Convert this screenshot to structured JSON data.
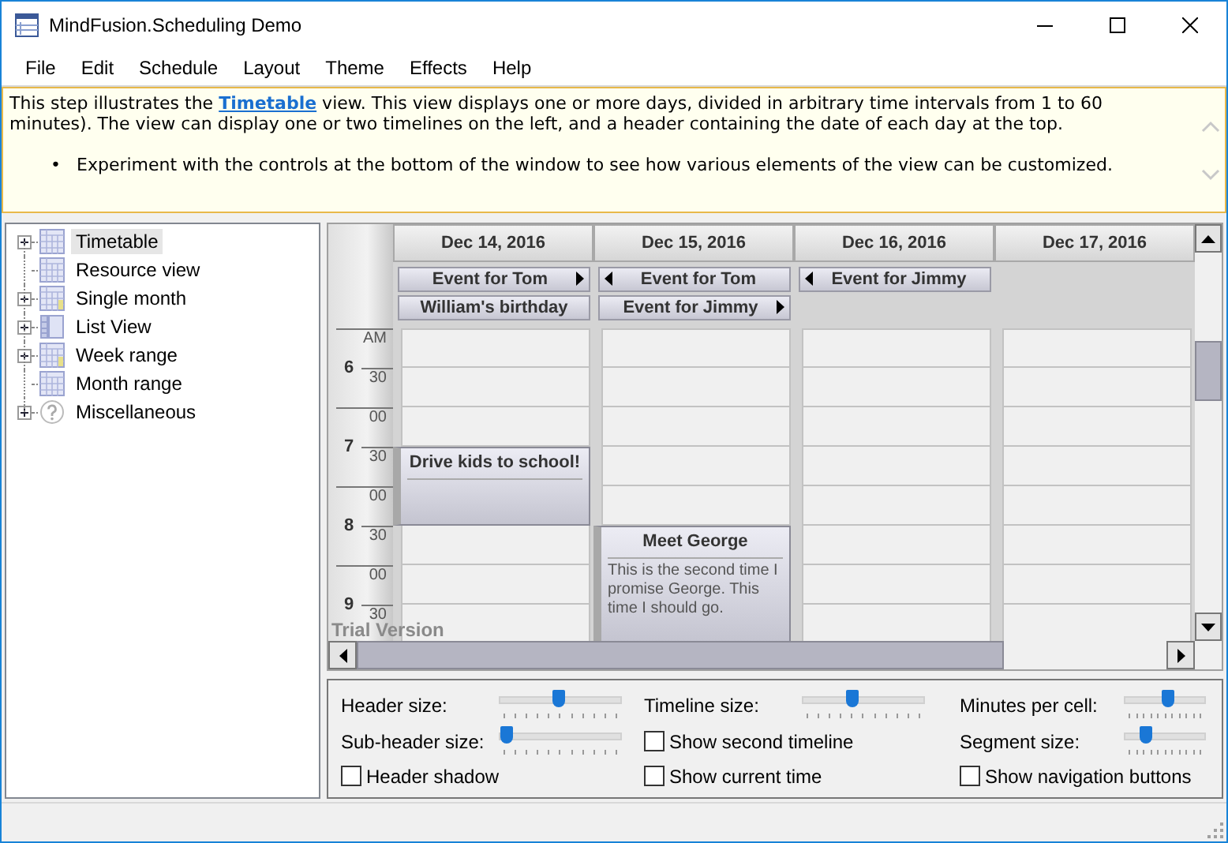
{
  "window": {
    "title": "MindFusion.Scheduling Demo"
  },
  "menu": [
    "File",
    "Edit",
    "Schedule",
    "Layout",
    "Theme",
    "Effects",
    "Help"
  ],
  "description": {
    "before": "This step illustrates the ",
    "link": "Timetable",
    "after": " view. This view displays one or more days, divided in arbitrary time intervals from 1 to 60 minutes). The view can display one or two timelines on the left, and a header containing the date of each day at the top.",
    "bullets": [
      {
        "marker": "•",
        "text": "Experiment with the controls at the bottom of the window to see how various elements of the view can be customized."
      }
    ]
  },
  "tree": [
    {
      "label": "Timetable",
      "expandable": true,
      "selected": true,
      "kind": "timetable"
    },
    {
      "label": "Resource view",
      "expandable": false,
      "selected": false,
      "kind": "resource"
    },
    {
      "label": "Single month",
      "expandable": true,
      "selected": false,
      "kind": "month"
    },
    {
      "label": "List View",
      "expandable": true,
      "selected": false,
      "kind": "list"
    },
    {
      "label": "Week range",
      "expandable": true,
      "selected": false,
      "kind": "week"
    },
    {
      "label": "Month range",
      "expandable": false,
      "selected": false,
      "kind": "monthrange"
    },
    {
      "label": "Miscellaneous",
      "expandable": true,
      "selected": false,
      "kind": "misc"
    }
  ],
  "timeline": [
    {
      "hour": "6",
      "minutes": [
        "AM",
        "30"
      ]
    },
    {
      "hour": "7",
      "minutes": [
        "00",
        "30"
      ]
    },
    {
      "hour": "8",
      "minutes": [
        "00",
        "30"
      ]
    },
    {
      "hour": "9",
      "minutes": [
        "00",
        "30"
      ]
    }
  ],
  "days": [
    {
      "date": "Dec 14, 2016",
      "all_day": [
        {
          "title": "Event for Tom",
          "continues_before": false,
          "continues_after": true
        },
        {
          "title": "William's birthday",
          "continues_before": false,
          "continues_after": false
        }
      ],
      "slots": [
        {
          "kind": "free"
        },
        {
          "kind": "free"
        },
        {
          "kind": "free"
        },
        {
          "kind": "event",
          "title": "Drive kids to school!"
        },
        {
          "kind": "continued"
        },
        {
          "kind": "free"
        },
        {
          "kind": "free"
        },
        {
          "kind": "free"
        }
      ]
    },
    {
      "date": "Dec 15, 2016",
      "all_day": [
        {
          "title": "Event for Tom",
          "continues_before": true,
          "continues_after": false
        },
        {
          "title": "Event for Jimmy",
          "continues_before": false,
          "continues_after": true
        }
      ],
      "slots": [
        {
          "kind": "free"
        },
        {
          "kind": "free"
        },
        {
          "kind": "free"
        },
        {
          "kind": "free"
        },
        {
          "kind": "free"
        },
        {
          "kind": "event",
          "title": "Meet George",
          "text": "This is the second time I promise George. This time I should go."
        },
        {
          "kind": "continued"
        },
        {
          "kind": "continued"
        }
      ]
    },
    {
      "date": "Dec 16, 2016",
      "all_day": [
        {
          "title": "Event for Jimmy",
          "continues_before": true,
          "continues_after": false
        }
      ],
      "slots": [
        {
          "kind": "free"
        },
        {
          "kind": "free"
        },
        {
          "kind": "free"
        },
        {
          "kind": "free"
        },
        {
          "kind": "free"
        },
        {
          "kind": "free"
        },
        {
          "kind": "free"
        },
        {
          "kind": "free"
        }
      ]
    },
    {
      "date": "Dec 17, 2016",
      "slots": [
        {
          "kind": "free"
        },
        {
          "kind": "free"
        },
        {
          "kind": "free"
        },
        {
          "kind": "free"
        },
        {
          "kind": "free"
        },
        {
          "kind": "free"
        },
        {
          "kind": "free"
        },
        {
          "kind": "free"
        }
      ]
    }
  ],
  "watermark_text": "Trial Version",
  "controls": [
    [
      {
        "kind": "slider",
        "label": "Header size:",
        "level": 0.48
      },
      {
        "kind": "slider",
        "label": "Sub-header size:",
        "level": 0.02
      },
      {
        "kind": "checkbox",
        "label": "Header shadow",
        "checked": false
      }
    ],
    [
      {
        "kind": "slider",
        "label": "Timeline size:",
        "level": 0.4
      },
      {
        "kind": "checkbox",
        "label": "Show second timeline",
        "checked": false
      },
      {
        "kind": "checkbox",
        "label": "Show current time",
        "checked": false
      }
    ],
    [
      {
        "kind": "slider",
        "label": "Minutes per cell:",
        "level": 0.55
      },
      {
        "kind": "slider",
        "label": "Segment size:",
        "level": 0.22
      },
      {
        "kind": "checkbox",
        "label": "Show navigation buttons",
        "checked": false
      }
    ]
  ]
}
